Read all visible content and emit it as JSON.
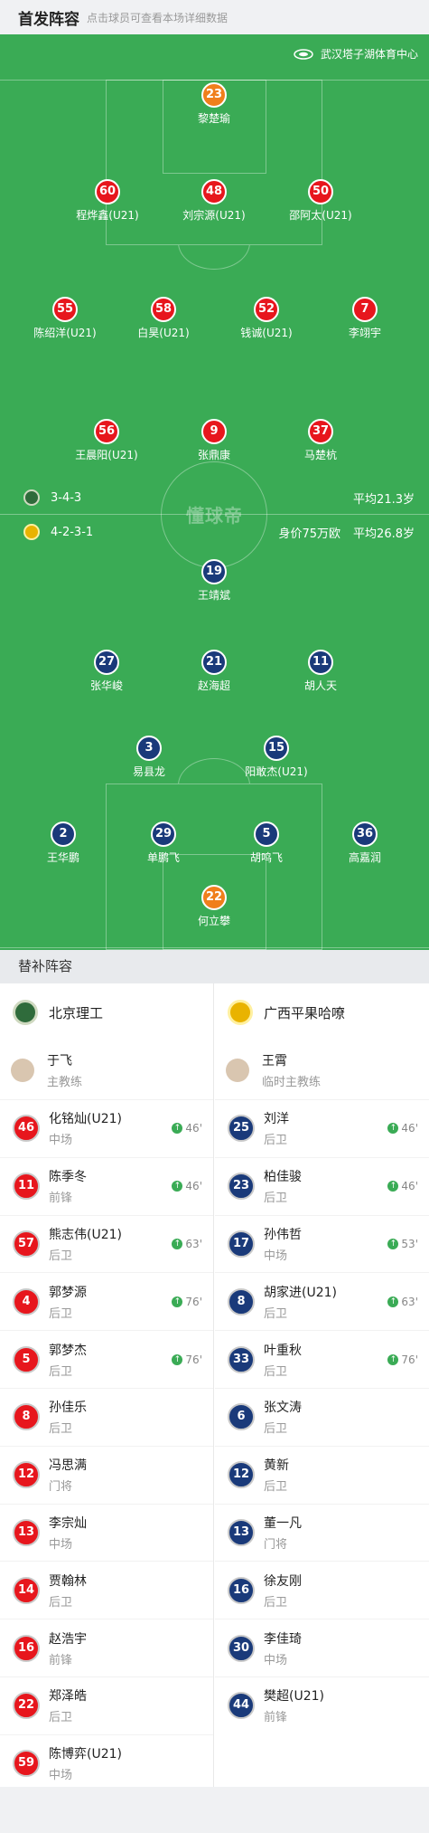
{
  "header": {
    "title": "首发阵容",
    "subtitle": "点击球员可查看本场详细数据"
  },
  "venue": "武汉塔子湖体育中心",
  "watermark": "懂球帝",
  "home": {
    "formation": "3-4-3",
    "avg_age": "平均21.3岁",
    "players": [
      {
        "no": "23",
        "name": "黎楚瑜",
        "gk": true
      },
      {
        "no": "60",
        "name": "程烨鑫(U21)"
      },
      {
        "no": "48",
        "name": "刘宗源(U21)"
      },
      {
        "no": "50",
        "name": "邵阿太(U21)",
        "yellow": true
      },
      {
        "no": "55",
        "name": "陈绍洋(U21)",
        "yellow": true
      },
      {
        "no": "58",
        "name": "白昊(U21)"
      },
      {
        "no": "52",
        "name": "钱诚(U21)",
        "sub": "46'"
      },
      {
        "no": "7",
        "name": "李翊宇",
        "sub": "46'",
        "captain": true
      },
      {
        "no": "56",
        "name": "王晨阳(U21)",
        "yellow": true,
        "sub": "76'"
      },
      {
        "no": "9",
        "name": "张鼎康",
        "yellow": true,
        "sub": "63'"
      },
      {
        "no": "37",
        "name": "马楚杭",
        "sub": "76'"
      }
    ]
  },
  "away": {
    "formation": "4-2-3-1",
    "value": "身价75万欧",
    "avg_age": "平均26.8岁",
    "players": [
      {
        "no": "19",
        "name": "王靖斌",
        "yellow": true
      },
      {
        "no": "27",
        "name": "张华峻",
        "goal": true
      },
      {
        "no": "21",
        "name": "赵海超",
        "yellow": true,
        "sub": "53'"
      },
      {
        "no": "11",
        "name": "胡人天",
        "sub": "76'",
        "captain": true
      },
      {
        "no": "3",
        "name": "易县龙"
      },
      {
        "no": "15",
        "name": "阳敢杰(U21)"
      },
      {
        "no": "2",
        "name": "王华鹏",
        "sub": "46'"
      },
      {
        "no": "29",
        "name": "单鹏飞",
        "sub": "46'"
      },
      {
        "no": "5",
        "name": "胡鸣飞"
      },
      {
        "no": "36",
        "name": "高嘉润",
        "yellow": true,
        "sub": "63'"
      },
      {
        "no": "22",
        "name": "何立攀",
        "gk": true
      }
    ]
  },
  "subs_title": "替补阵容",
  "bench_home": {
    "team": "北京理工",
    "coach": {
      "name": "于飞",
      "role": "主教练"
    },
    "players": [
      {
        "no": "46",
        "name": "化铭灿(U21)",
        "pos": "中场",
        "in": "46'"
      },
      {
        "no": "11",
        "name": "陈季冬",
        "pos": "前锋",
        "in": "46'"
      },
      {
        "no": "57",
        "name": "熊志伟(U21)",
        "pos": "后卫",
        "in": "63'"
      },
      {
        "no": "4",
        "name": "郭梦源",
        "pos": "后卫",
        "in": "76'"
      },
      {
        "no": "5",
        "name": "郭梦杰",
        "pos": "后卫",
        "in": "76'"
      },
      {
        "no": "8",
        "name": "孙佳乐",
        "pos": "后卫"
      },
      {
        "no": "12",
        "name": "冯思满",
        "pos": "门将"
      },
      {
        "no": "13",
        "name": "李宗灿",
        "pos": "中场"
      },
      {
        "no": "14",
        "name": "贾翰林",
        "pos": "后卫"
      },
      {
        "no": "16",
        "name": "赵浩宇",
        "pos": "前锋"
      },
      {
        "no": "22",
        "name": "郑泽皓",
        "pos": "后卫"
      },
      {
        "no": "59",
        "name": "陈博弈(U21)",
        "pos": "中场"
      }
    ]
  },
  "bench_away": {
    "team": "广西平果哈嘹",
    "coach": {
      "name": "王霄",
      "role": "临时主教练"
    },
    "players": [
      {
        "no": "25",
        "name": "刘洋",
        "pos": "后卫",
        "in": "46'"
      },
      {
        "no": "23",
        "name": "柏佳骏",
        "pos": "后卫",
        "in": "46'"
      },
      {
        "no": "17",
        "name": "孙伟哲",
        "pos": "中场",
        "in": "53'"
      },
      {
        "no": "8",
        "name": "胡家进(U21)",
        "pos": "后卫",
        "in": "63'"
      },
      {
        "no": "33",
        "name": "叶重秋",
        "pos": "后卫",
        "in": "76'"
      },
      {
        "no": "6",
        "name": "张文涛",
        "pos": "后卫"
      },
      {
        "no": "12",
        "name": "黄新",
        "pos": "后卫"
      },
      {
        "no": "13",
        "name": "董一凡",
        "pos": "门将"
      },
      {
        "no": "16",
        "name": "徐友刚",
        "pos": "后卫"
      },
      {
        "no": "30",
        "name": "李佳琦",
        "pos": "中场"
      },
      {
        "no": "44",
        "name": "樊超(U21)",
        "pos": "前锋"
      }
    ]
  },
  "colors": {
    "pitch": "#3aab55",
    "home": "#e7161d",
    "away": "#1a3a7a",
    "gk": "#f07f1c"
  }
}
